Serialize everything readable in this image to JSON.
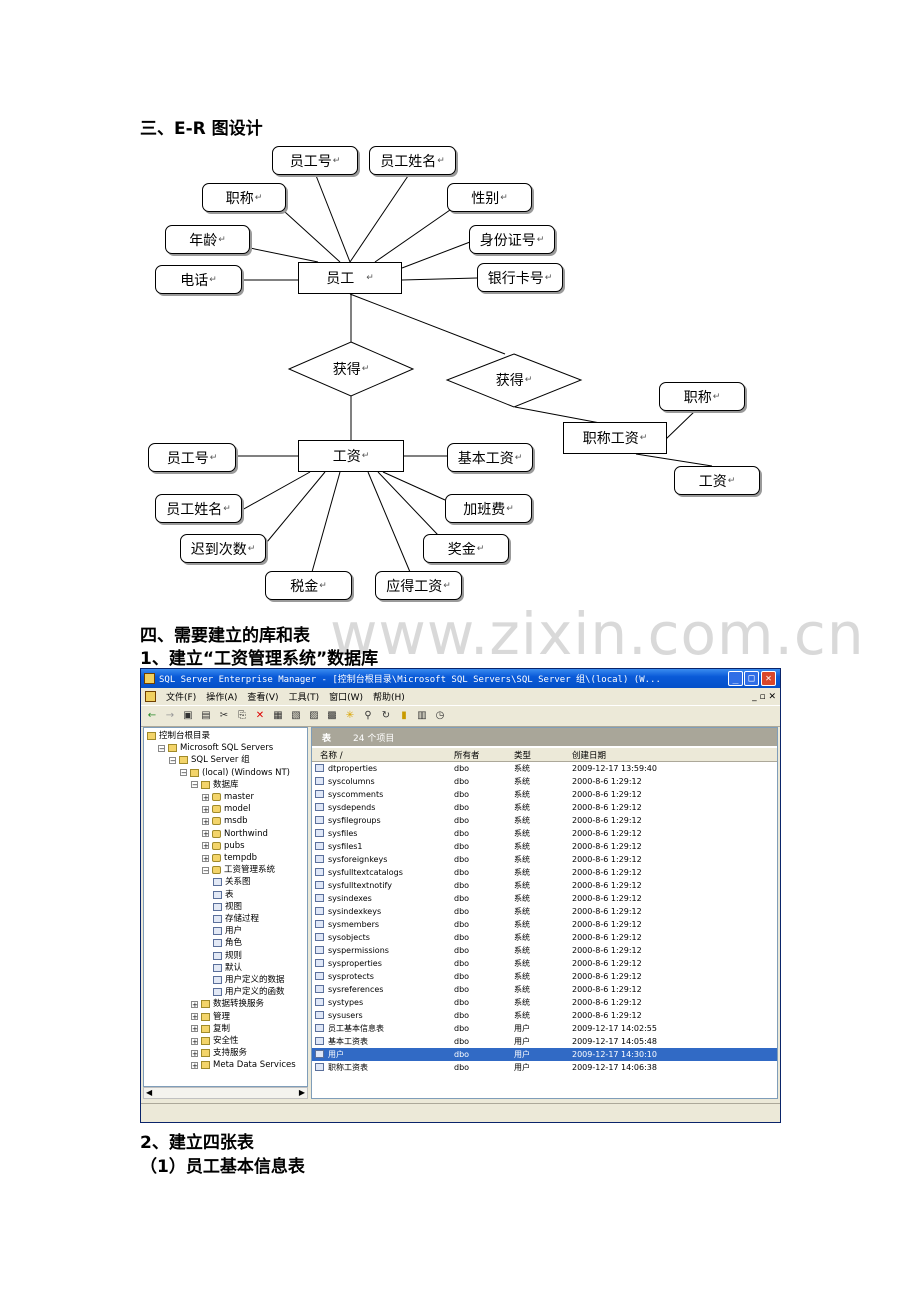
{
  "headings": {
    "er_title": "三、E-R 图设计",
    "section4": "四、需要建立的库和表",
    "step1": "1、建立“工资管理系统”数据库",
    "step2": "2、建立四张表",
    "step2_1": "（1）员工基本信息表"
  },
  "watermark": "www.zixin.com.cn",
  "er": {
    "entities": {
      "employee": "员工",
      "salary": "工资",
      "title_salary": "职称工资"
    },
    "relations": {
      "get1": "获得",
      "get2": "获得"
    },
    "employee_attrs": [
      "员工号",
      "员工姓名",
      "职称",
      "性别",
      "年龄",
      "身份证号",
      "电话",
      "银行卡号"
    ],
    "salary_attrs": [
      "员工号",
      "基本工资",
      "员工姓名",
      "加班费",
      "迟到次数",
      "奖金",
      "税金",
      "应得工资"
    ],
    "title_salary_attrs": [
      "职称",
      "工资"
    ],
    "return_mark": "↵"
  },
  "window": {
    "title": "SQL Server Enterprise Manager - [控制台根目录\\Microsoft SQL Servers\\SQL Server 组\\(local) (W...",
    "menu": [
      "文件(F)",
      "操作(A)",
      "查看(V)",
      "工具(T)",
      "窗口(W)",
      "帮助(H)"
    ],
    "tree": [
      {
        "label": "控制台根目录",
        "depth": 0
      },
      {
        "label": "Microsoft SQL Servers",
        "depth": 1
      },
      {
        "label": "SQL Server 组",
        "depth": 2
      },
      {
        "label": "(local) (Windows NT)",
        "depth": 3
      },
      {
        "label": "数据库",
        "depth": 4
      },
      {
        "label": "master",
        "depth": 5
      },
      {
        "label": "model",
        "depth": 5
      },
      {
        "label": "msdb",
        "depth": 5
      },
      {
        "label": "Northwind",
        "depth": 5
      },
      {
        "label": "pubs",
        "depth": 5
      },
      {
        "label": "tempdb",
        "depth": 5
      },
      {
        "label": "工资管理系统",
        "depth": 5
      },
      {
        "label": "关系图",
        "depth": 6
      },
      {
        "label": "表",
        "depth": 6
      },
      {
        "label": "视图",
        "depth": 6
      },
      {
        "label": "存储过程",
        "depth": 6
      },
      {
        "label": "用户",
        "depth": 6
      },
      {
        "label": "角色",
        "depth": 6
      },
      {
        "label": "规则",
        "depth": 6
      },
      {
        "label": "默认",
        "depth": 6
      },
      {
        "label": "用户定义的数据",
        "depth": 6
      },
      {
        "label": "用户定义的函数",
        "depth": 6
      },
      {
        "label": "数据转换服务",
        "depth": 4
      },
      {
        "label": "管理",
        "depth": 4
      },
      {
        "label": "复制",
        "depth": 4
      },
      {
        "label": "安全性",
        "depth": 4
      },
      {
        "label": "支持服务",
        "depth": 4
      },
      {
        "label": "Meta Data Services",
        "depth": 4
      }
    ],
    "pane_header": {
      "label": "表",
      "count": "24 个项目"
    },
    "columns": [
      "名称 /",
      "所有者",
      "类型",
      "创建日期"
    ],
    "rows": [
      [
        "dtproperties",
        "dbo",
        "系统",
        "2009-12-17 13:59:40"
      ],
      [
        "syscolumns",
        "dbo",
        "系统",
        "2000-8-6 1:29:12"
      ],
      [
        "syscomments",
        "dbo",
        "系统",
        "2000-8-6 1:29:12"
      ],
      [
        "sysdepends",
        "dbo",
        "系统",
        "2000-8-6 1:29:12"
      ],
      [
        "sysfilegroups",
        "dbo",
        "系统",
        "2000-8-6 1:29:12"
      ],
      [
        "sysfiles",
        "dbo",
        "系统",
        "2000-8-6 1:29:12"
      ],
      [
        "sysfiles1",
        "dbo",
        "系统",
        "2000-8-6 1:29:12"
      ],
      [
        "sysforeignkeys",
        "dbo",
        "系统",
        "2000-8-6 1:29:12"
      ],
      [
        "sysfulltextcatalogs",
        "dbo",
        "系统",
        "2000-8-6 1:29:12"
      ],
      [
        "sysfulltextnotify",
        "dbo",
        "系统",
        "2000-8-6 1:29:12"
      ],
      [
        "sysindexes",
        "dbo",
        "系统",
        "2000-8-6 1:29:12"
      ],
      [
        "sysindexkeys",
        "dbo",
        "系统",
        "2000-8-6 1:29:12"
      ],
      [
        "sysmembers",
        "dbo",
        "系统",
        "2000-8-6 1:29:12"
      ],
      [
        "sysobjects",
        "dbo",
        "系统",
        "2000-8-6 1:29:12"
      ],
      [
        "syspermissions",
        "dbo",
        "系统",
        "2000-8-6 1:29:12"
      ],
      [
        "sysproperties",
        "dbo",
        "系统",
        "2000-8-6 1:29:12"
      ],
      [
        "sysprotects",
        "dbo",
        "系统",
        "2000-8-6 1:29:12"
      ],
      [
        "sysreferences",
        "dbo",
        "系统",
        "2000-8-6 1:29:12"
      ],
      [
        "systypes",
        "dbo",
        "系统",
        "2000-8-6 1:29:12"
      ],
      [
        "sysusers",
        "dbo",
        "系统",
        "2000-8-6 1:29:12"
      ],
      [
        "员工基本信息表",
        "dbo",
        "用户",
        "2009-12-17 14:02:55"
      ],
      [
        "基本工资表",
        "dbo",
        "用户",
        "2009-12-17 14:05:48"
      ],
      [
        "用户",
        "dbo",
        "用户",
        "2009-12-17 14:30:10"
      ],
      [
        "职称工资表",
        "dbo",
        "用户",
        "2009-12-17 14:06:38"
      ]
    ],
    "selected_row": 22,
    "colors": {
      "title": "#0a5ad8",
      "selection": "#316ac5"
    }
  }
}
